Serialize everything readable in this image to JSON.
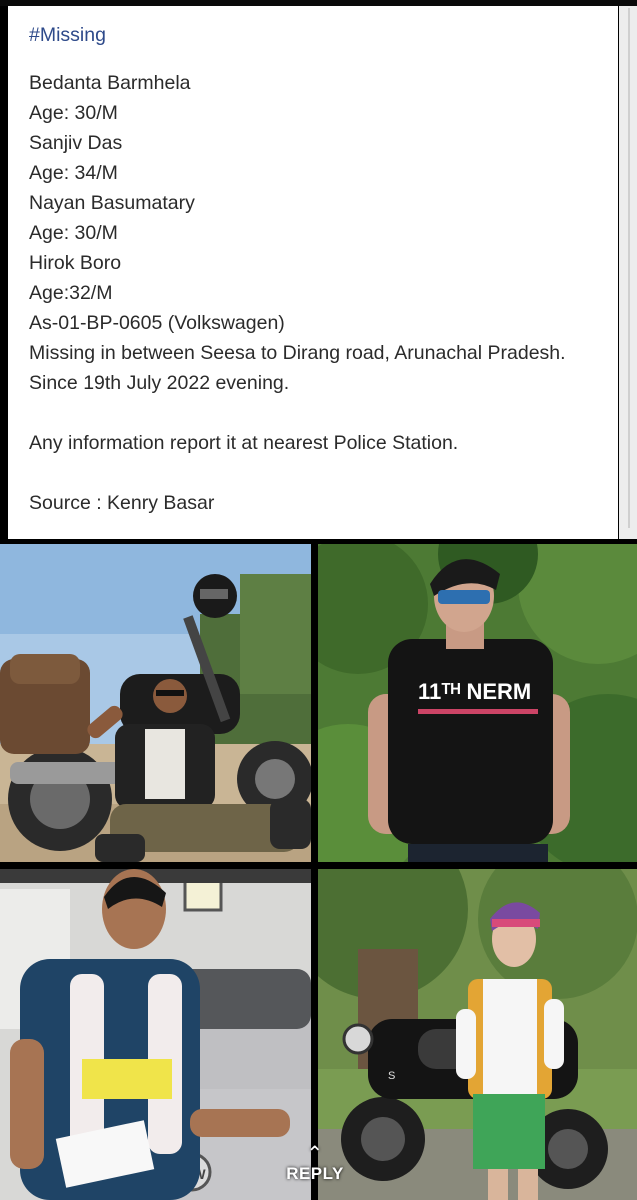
{
  "post": {
    "hashtag": "#Missing",
    "lines": [
      "Bedanta Barmhela",
      "Age: 30/M",
      "Sanjiv Das",
      "Age: 34/M",
      "Nayan Basumatary",
      "Age: 30/M",
      "Hirok Boro",
      "Age:32/M",
      "As-01-BP-0605 (Volkswagen)"
    ],
    "location": "Missing in between Seesa to Dirang road, Arunachal Pradesh. Since  19th July 2022 evening.",
    "appeal": "Any information report it at nearest Police Station.",
    "source": "Source : Kenry Basar"
  },
  "photo_text": {
    "shirt_print": "11ᵀᴴ NERM",
    "plate": "S"
  },
  "controls": {
    "reply_label": "REPLY",
    "reply_icon": "up-arrow-icon"
  },
  "colors": {
    "hashtag": "#2e4a8a",
    "text": "#2b2b2b",
    "background": "#000000"
  }
}
